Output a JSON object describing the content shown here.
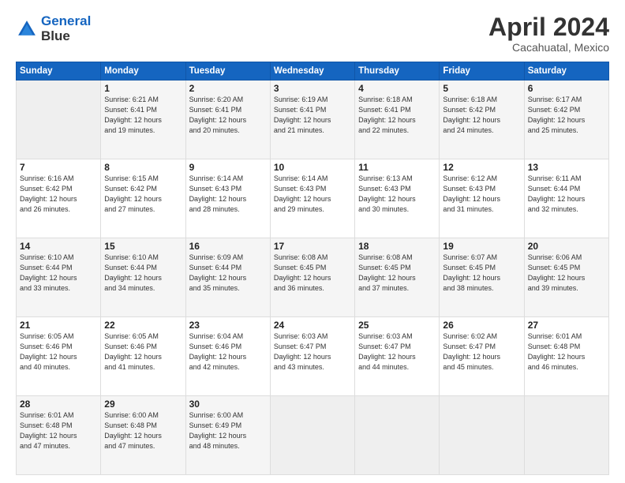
{
  "logo": {
    "line1": "General",
    "line2": "Blue"
  },
  "header": {
    "month": "April 2024",
    "location": "Cacahuatal, Mexico"
  },
  "weekdays": [
    "Sunday",
    "Monday",
    "Tuesday",
    "Wednesday",
    "Thursday",
    "Friday",
    "Saturday"
  ],
  "weeks": [
    [
      {
        "num": "",
        "info": ""
      },
      {
        "num": "1",
        "info": "Sunrise: 6:21 AM\nSunset: 6:41 PM\nDaylight: 12 hours\nand 19 minutes."
      },
      {
        "num": "2",
        "info": "Sunrise: 6:20 AM\nSunset: 6:41 PM\nDaylight: 12 hours\nand 20 minutes."
      },
      {
        "num": "3",
        "info": "Sunrise: 6:19 AM\nSunset: 6:41 PM\nDaylight: 12 hours\nand 21 minutes."
      },
      {
        "num": "4",
        "info": "Sunrise: 6:18 AM\nSunset: 6:41 PM\nDaylight: 12 hours\nand 22 minutes."
      },
      {
        "num": "5",
        "info": "Sunrise: 6:18 AM\nSunset: 6:42 PM\nDaylight: 12 hours\nand 24 minutes."
      },
      {
        "num": "6",
        "info": "Sunrise: 6:17 AM\nSunset: 6:42 PM\nDaylight: 12 hours\nand 25 minutes."
      }
    ],
    [
      {
        "num": "7",
        "info": "Sunrise: 6:16 AM\nSunset: 6:42 PM\nDaylight: 12 hours\nand 26 minutes."
      },
      {
        "num": "8",
        "info": "Sunrise: 6:15 AM\nSunset: 6:42 PM\nDaylight: 12 hours\nand 27 minutes."
      },
      {
        "num": "9",
        "info": "Sunrise: 6:14 AM\nSunset: 6:43 PM\nDaylight: 12 hours\nand 28 minutes."
      },
      {
        "num": "10",
        "info": "Sunrise: 6:14 AM\nSunset: 6:43 PM\nDaylight: 12 hours\nand 29 minutes."
      },
      {
        "num": "11",
        "info": "Sunrise: 6:13 AM\nSunset: 6:43 PM\nDaylight: 12 hours\nand 30 minutes."
      },
      {
        "num": "12",
        "info": "Sunrise: 6:12 AM\nSunset: 6:43 PM\nDaylight: 12 hours\nand 31 minutes."
      },
      {
        "num": "13",
        "info": "Sunrise: 6:11 AM\nSunset: 6:44 PM\nDaylight: 12 hours\nand 32 minutes."
      }
    ],
    [
      {
        "num": "14",
        "info": "Sunrise: 6:10 AM\nSunset: 6:44 PM\nDaylight: 12 hours\nand 33 minutes."
      },
      {
        "num": "15",
        "info": "Sunrise: 6:10 AM\nSunset: 6:44 PM\nDaylight: 12 hours\nand 34 minutes."
      },
      {
        "num": "16",
        "info": "Sunrise: 6:09 AM\nSunset: 6:44 PM\nDaylight: 12 hours\nand 35 minutes."
      },
      {
        "num": "17",
        "info": "Sunrise: 6:08 AM\nSunset: 6:45 PM\nDaylight: 12 hours\nand 36 minutes."
      },
      {
        "num": "18",
        "info": "Sunrise: 6:08 AM\nSunset: 6:45 PM\nDaylight: 12 hours\nand 37 minutes."
      },
      {
        "num": "19",
        "info": "Sunrise: 6:07 AM\nSunset: 6:45 PM\nDaylight: 12 hours\nand 38 minutes."
      },
      {
        "num": "20",
        "info": "Sunrise: 6:06 AM\nSunset: 6:45 PM\nDaylight: 12 hours\nand 39 minutes."
      }
    ],
    [
      {
        "num": "21",
        "info": "Sunrise: 6:05 AM\nSunset: 6:46 PM\nDaylight: 12 hours\nand 40 minutes."
      },
      {
        "num": "22",
        "info": "Sunrise: 6:05 AM\nSunset: 6:46 PM\nDaylight: 12 hours\nand 41 minutes."
      },
      {
        "num": "23",
        "info": "Sunrise: 6:04 AM\nSunset: 6:46 PM\nDaylight: 12 hours\nand 42 minutes."
      },
      {
        "num": "24",
        "info": "Sunrise: 6:03 AM\nSunset: 6:47 PM\nDaylight: 12 hours\nand 43 minutes."
      },
      {
        "num": "25",
        "info": "Sunrise: 6:03 AM\nSunset: 6:47 PM\nDaylight: 12 hours\nand 44 minutes."
      },
      {
        "num": "26",
        "info": "Sunrise: 6:02 AM\nSunset: 6:47 PM\nDaylight: 12 hours\nand 45 minutes."
      },
      {
        "num": "27",
        "info": "Sunrise: 6:01 AM\nSunset: 6:48 PM\nDaylight: 12 hours\nand 46 minutes."
      }
    ],
    [
      {
        "num": "28",
        "info": "Sunrise: 6:01 AM\nSunset: 6:48 PM\nDaylight: 12 hours\nand 47 minutes."
      },
      {
        "num": "29",
        "info": "Sunrise: 6:00 AM\nSunset: 6:48 PM\nDaylight: 12 hours\nand 47 minutes."
      },
      {
        "num": "30",
        "info": "Sunrise: 6:00 AM\nSunset: 6:49 PM\nDaylight: 12 hours\nand 48 minutes."
      },
      {
        "num": "",
        "info": ""
      },
      {
        "num": "",
        "info": ""
      },
      {
        "num": "",
        "info": ""
      },
      {
        "num": "",
        "info": ""
      }
    ]
  ]
}
